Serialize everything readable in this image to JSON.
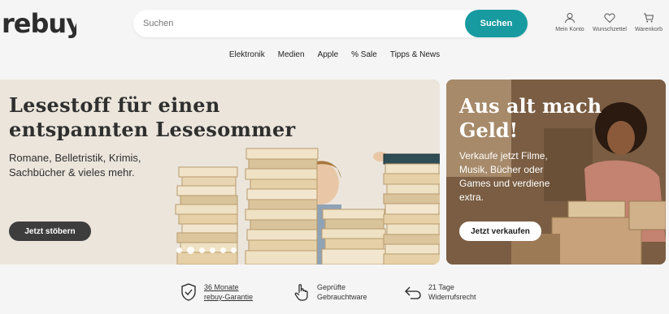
{
  "brand": {
    "logo_text": "rebuy"
  },
  "search": {
    "placeholder": "Suchen",
    "button_label": "Suchen"
  },
  "header_actions": [
    {
      "label": "Mein Konto",
      "icon": "user-icon"
    },
    {
      "label": "Wunschzettel",
      "icon": "heart-icon"
    },
    {
      "label": "Warenkorb",
      "icon": "cart-icon"
    }
  ],
  "nav": {
    "items": [
      "Elektronik",
      "Medien",
      "Apple",
      "% Sale",
      "Tipps & News"
    ]
  },
  "hero_left": {
    "title": "Lesestoff für einen entspannten Lesesommer",
    "subtitle": "Romane, Belletristik, Krimis, Sachbücher & vieles mehr.",
    "button_label": "Jetzt stöbern",
    "carousel": {
      "total": 6,
      "active_index": 1
    }
  },
  "hero_right": {
    "title": "Aus alt mach Geld!",
    "subtitle": "Verkaufe jetzt Filme, Musik, Bücher oder Games und verdiene extra.",
    "button_label": "Jetzt verkaufen"
  },
  "usps": [
    {
      "line1": "36 Monate",
      "line2": "rebuy-Garantie",
      "icon": "shield-check-icon"
    },
    {
      "line1": "Geprüfte",
      "line2": "Gebrauchtware",
      "icon": "hand-pointer-icon"
    },
    {
      "line1": "21 Tage",
      "line2": "Widerrufsrecht",
      "icon": "return-arrow-icon"
    }
  ],
  "colors": {
    "accent": "#179aa0",
    "dark_button": "#3d3d3d",
    "background": "#f5f5f5"
  }
}
